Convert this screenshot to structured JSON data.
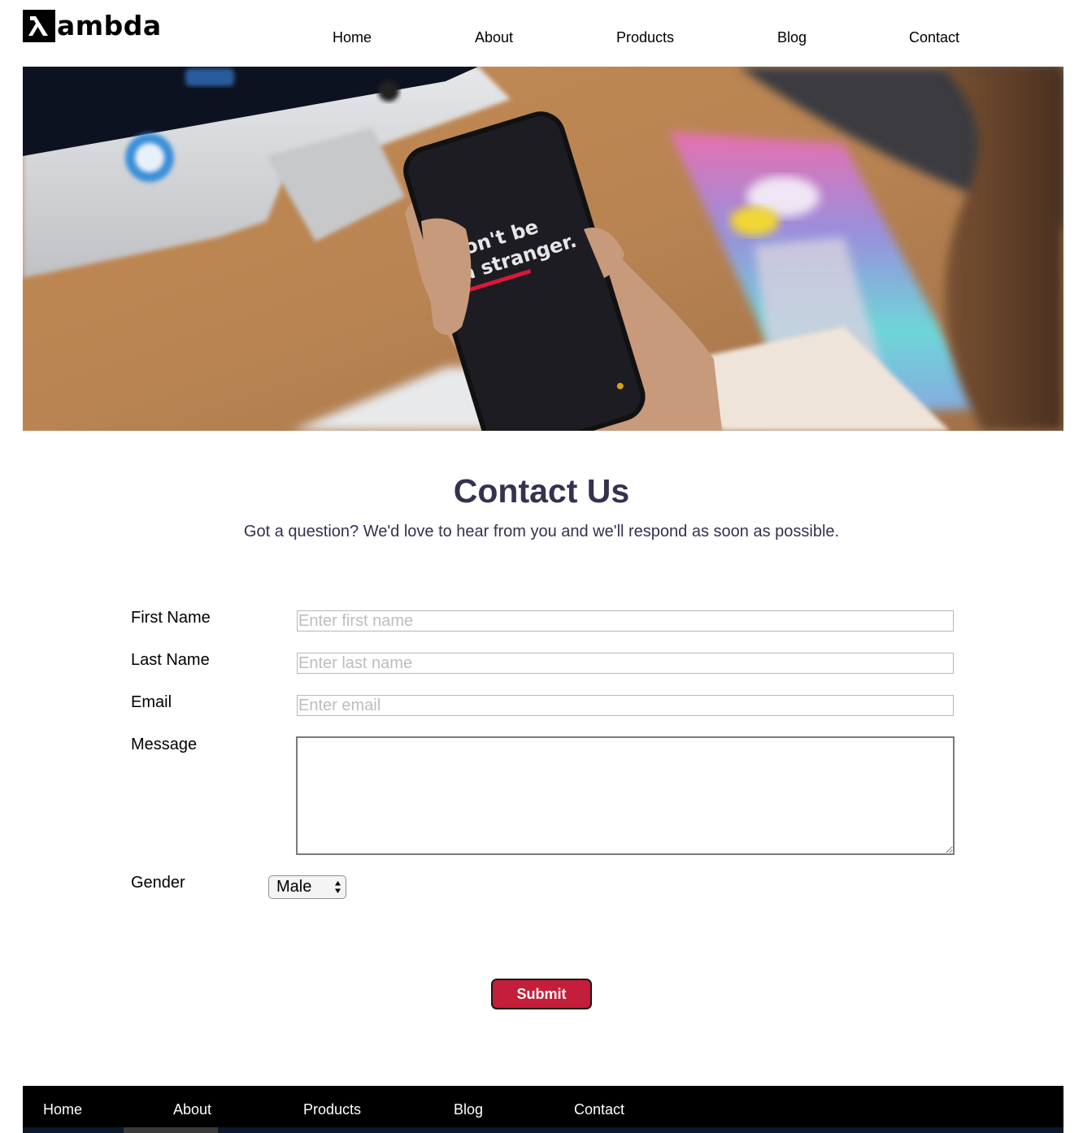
{
  "brand": {
    "name": "ambda",
    "symbol": "λ"
  },
  "nav": {
    "items": [
      "Home",
      "About",
      "Products",
      "Blog",
      "Contact"
    ]
  },
  "hero": {
    "phone_text_line1": "don't be",
    "phone_text_line2": "a stranger."
  },
  "contact": {
    "title": "Contact Us",
    "subtitle": "Got a question? We'd love to hear from you and we'll respond as soon as possible."
  },
  "form": {
    "first_name": {
      "label": "First Name",
      "placeholder": "Enter first name",
      "value": ""
    },
    "last_name": {
      "label": "Last Name",
      "placeholder": "Enter last name",
      "value": ""
    },
    "email": {
      "label": "Email",
      "placeholder": "Enter email",
      "value": ""
    },
    "message": {
      "label": "Message",
      "value": ""
    },
    "gender": {
      "label": "Gender",
      "selected": "Male"
    },
    "submit_label": "Submit"
  },
  "footer": {
    "items": [
      "Home",
      "About",
      "Products",
      "Blog",
      "Contact"
    ]
  },
  "colors": {
    "heading": "#35314f",
    "submit": "#c41e3a",
    "footer_bg": "#000000"
  }
}
